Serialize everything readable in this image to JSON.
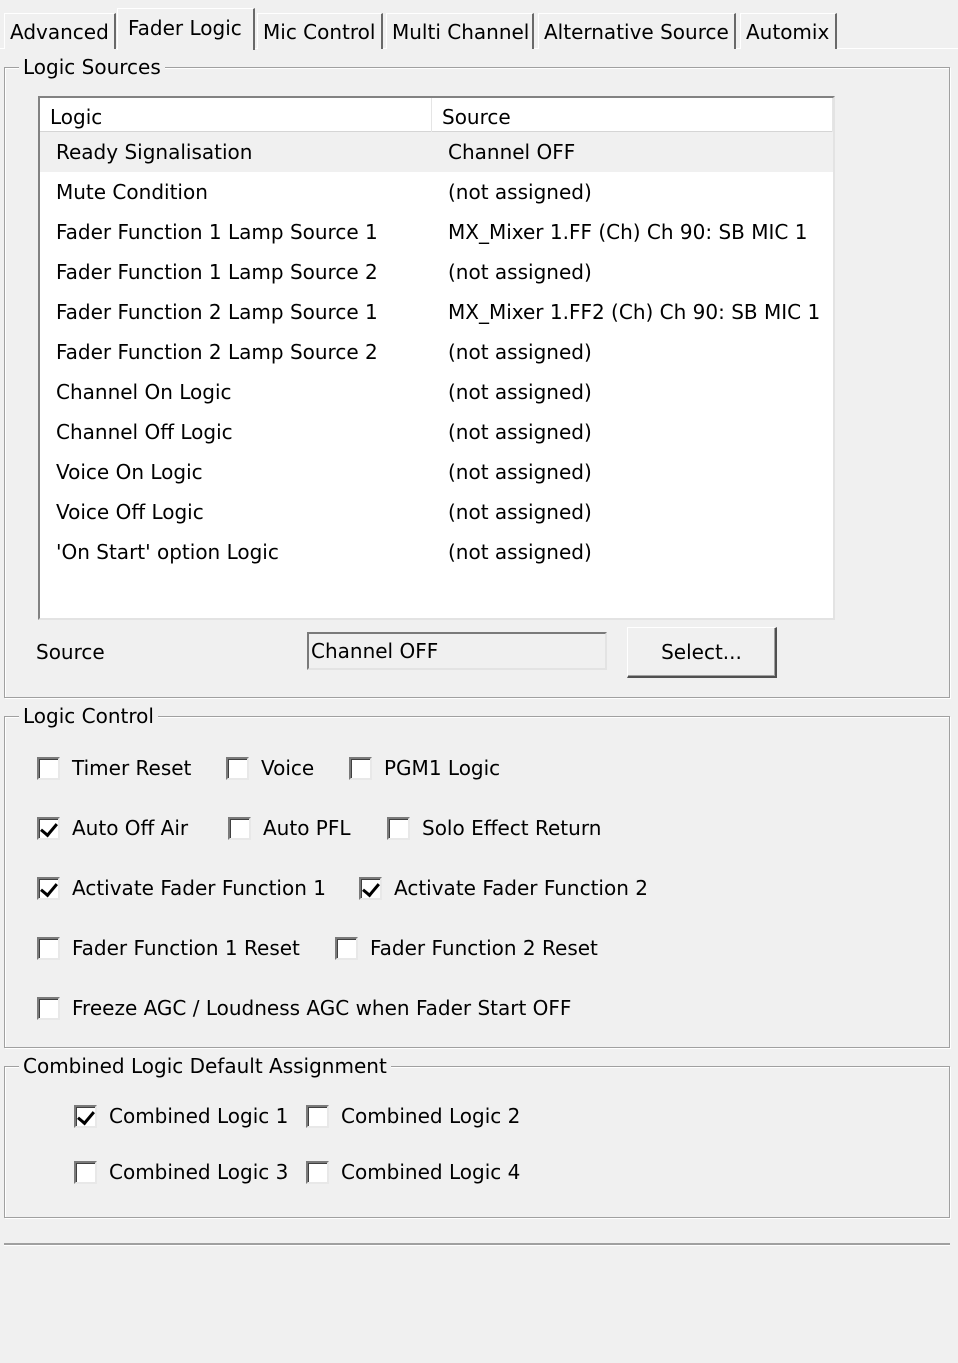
{
  "tabs": [
    {
      "label": "Advanced",
      "active": false
    },
    {
      "label": "Fader Logic",
      "active": true
    },
    {
      "label": "Mic Control",
      "active": false
    },
    {
      "label": "Multi Channel",
      "active": false
    },
    {
      "label": "Alternative Source",
      "active": false
    },
    {
      "label": "Automix",
      "active": false
    }
  ],
  "logic_sources": {
    "title": "Logic Sources",
    "columns": [
      "Logic",
      "Source"
    ],
    "rows": [
      {
        "logic": "Ready Signalisation",
        "source": "Channel OFF",
        "selected": true
      },
      {
        "logic": "Mute Condition",
        "source": "(not assigned)"
      },
      {
        "logic": "Fader Function 1 Lamp Source 1",
        "source": "MX_Mixer 1.FF (Ch) Ch 90: SB MIC  1"
      },
      {
        "logic": "Fader Function 1 Lamp Source 2",
        "source": "(not assigned)"
      },
      {
        "logic": "Fader Function 2 Lamp Source 1",
        "source": "MX_Mixer 1.FF2 (Ch) Ch 90: SB MIC  1"
      },
      {
        "logic": "Fader Function 2 Lamp Source 2",
        "source": "(not assigned)"
      },
      {
        "logic": "Channel On Logic",
        "source": "(not assigned)"
      },
      {
        "logic": "Channel Off Logic",
        "source": "(not assigned)"
      },
      {
        "logic": "Voice On Logic",
        "source": "(not assigned)"
      },
      {
        "logic": "Voice Off Logic",
        "source": "(not assigned)"
      },
      {
        "logic": "'On Start' option Logic",
        "source": "(not assigned)"
      }
    ],
    "source_label": "Source",
    "source_value": "Channel OFF",
    "select_button": "Select..."
  },
  "logic_control": {
    "title": "Logic Control",
    "checkboxes": [
      {
        "label": "Timer Reset",
        "checked": false
      },
      {
        "label": "Voice",
        "checked": false
      },
      {
        "label": "PGM1 Logic",
        "checked": false
      },
      {
        "label": "Auto Off Air",
        "checked": true
      },
      {
        "label": "Auto PFL",
        "checked": false
      },
      {
        "label": "Solo Effect Return",
        "checked": false
      },
      {
        "label": "Activate Fader Function 1",
        "checked": true
      },
      {
        "label": "Activate Fader Function 2",
        "checked": true
      },
      {
        "label": "Fader Function 1 Reset",
        "checked": false
      },
      {
        "label": "Fader Function 2 Reset",
        "checked": false
      },
      {
        "label": "Freeze AGC / Loudness AGC when Fader Start OFF",
        "checked": false
      }
    ]
  },
  "combined_logic": {
    "title": "Combined Logic Default Assignment",
    "checkboxes": [
      {
        "label": "Combined Logic 1",
        "checked": true
      },
      {
        "label": "Combined Logic 2",
        "checked": false
      },
      {
        "label": "Combined Logic 3",
        "checked": false
      },
      {
        "label": "Combined Logic 4",
        "checked": false
      }
    ]
  }
}
